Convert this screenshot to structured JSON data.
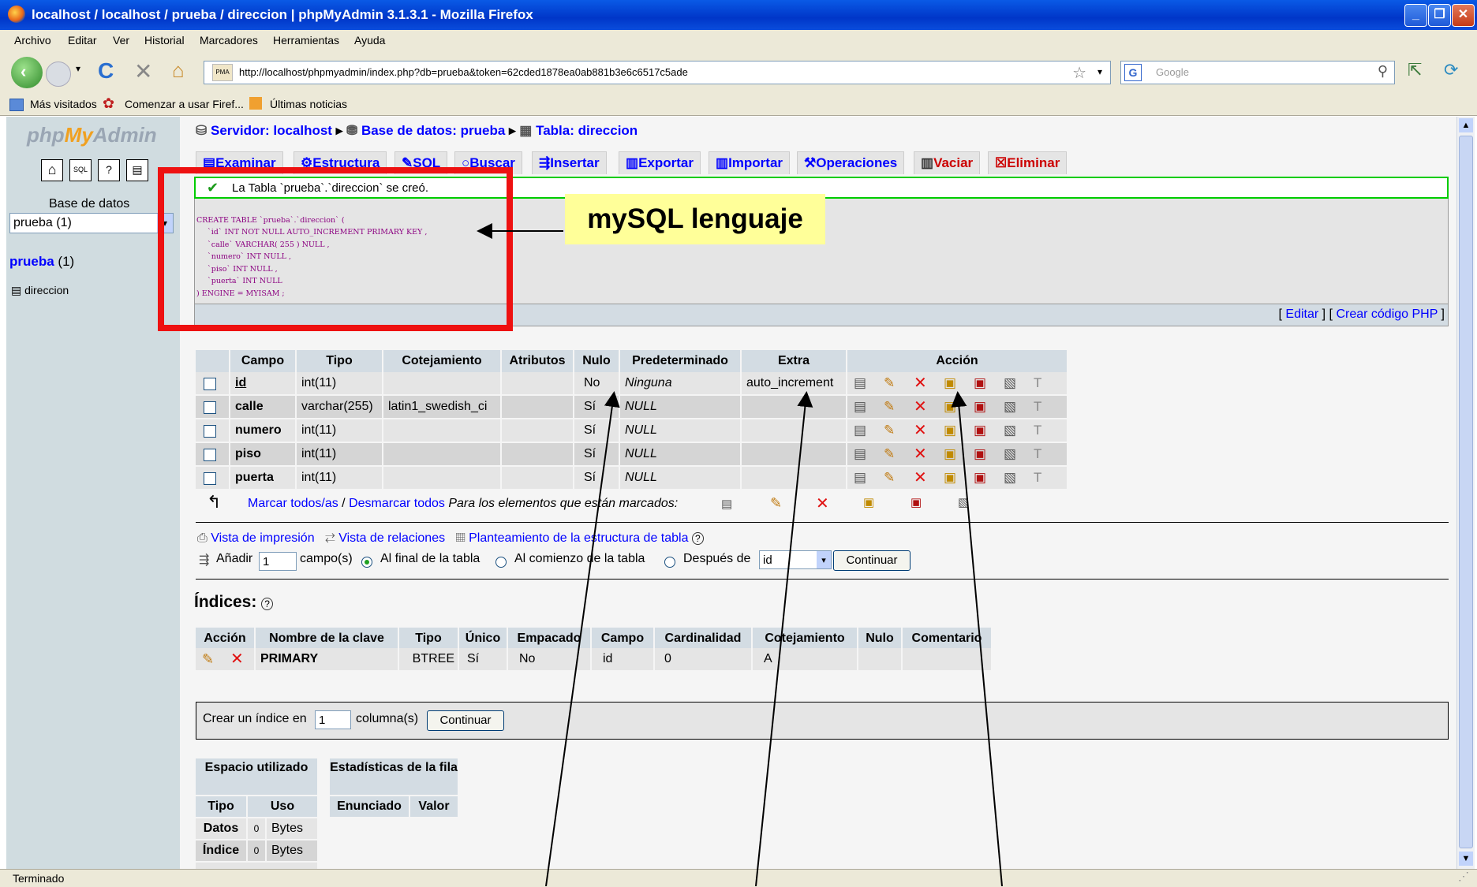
{
  "window": {
    "title": "localhost / localhost / prueba / direccion | phpMyAdmin 3.1.3.1 - Mozilla Firefox"
  },
  "menu": [
    "Archivo",
    "Editar",
    "Ver",
    "Historial",
    "Marcadores",
    "Herramientas",
    "Ayuda"
  ],
  "nav": {
    "url": "http://localhost/phpmyadmin/index.php?db=prueba&token=62cded1878ea0ab881b3e6c6517c5ade",
    "search_placeholder": "Google"
  },
  "bookmarks": [
    "Más visitados",
    "Comenzar a usar Firef...",
    "Últimas noticias"
  ],
  "left": {
    "logo": "phpMyAdmin",
    "db_label": "Base de datos",
    "db_select": "prueba (1)",
    "db_link": "prueba",
    "db_count": "(1)",
    "table": "direccion"
  },
  "breadcrumb": {
    "server": "Servidor: localhost",
    "database": "Base de datos: prueba",
    "table": "Tabla: direccion"
  },
  "tabs": [
    "Examinar",
    "Estructura",
    "SQL",
    "Buscar",
    "Insertar",
    "Exportar",
    "Importar",
    "Operaciones",
    "Vaciar",
    "Eliminar"
  ],
  "success": {
    "message": "La Tabla `prueba`.`direccion` se creó.",
    "sql_lines": [
      "CREATE TABLE `prueba`.`direccion` (",
      "`id` INT NOT NULL AUTO_INCREMENT PRIMARY KEY ,",
      "`calle` VARCHAR( 255 ) NULL ,",
      "`numero` INT NULL ,",
      "`piso` INT NULL ,",
      "`puerta` INT NULL",
      ") ENGINE = MYISAM ;"
    ],
    "edit_link": "Editar",
    "php_link": "Crear código PHP"
  },
  "annotation": {
    "label": "mySQL lenguaje"
  },
  "structure": {
    "headers": [
      "Campo",
      "Tipo",
      "Cotejamiento",
      "Atributos",
      "Nulo",
      "Predeterminado",
      "Extra",
      "Acción"
    ],
    "rows": [
      {
        "campo": "id",
        "tipo": "int(11)",
        "cotejamiento": "",
        "atributos": "",
        "nulo": "No",
        "predeterminado": "Ninguna",
        "extra": "auto_increment"
      },
      {
        "campo": "calle",
        "tipo": "varchar(255)",
        "cotejamiento": "latin1_swedish_ci",
        "atributos": "",
        "nulo": "Sí",
        "predeterminado": "NULL",
        "extra": ""
      },
      {
        "campo": "numero",
        "tipo": "int(11)",
        "cotejamiento": "",
        "atributos": "",
        "nulo": "Sí",
        "predeterminado": "NULL",
        "extra": ""
      },
      {
        "campo": "piso",
        "tipo": "int(11)",
        "cotejamiento": "",
        "atributos": "",
        "nulo": "Sí",
        "predeterminado": "NULL",
        "extra": ""
      },
      {
        "campo": "puerta",
        "tipo": "int(11)",
        "cotejamiento": "",
        "atributos": "",
        "nulo": "Sí",
        "predeterminado": "NULL",
        "extra": ""
      }
    ],
    "check_all": "Marcar todos/as",
    "sep": "/",
    "uncheck_all": "Desmarcar todos",
    "with_selected": "Para los elementos que están marcados:"
  },
  "links": {
    "print": "Vista de impresión",
    "relations": "Vista de relaciones",
    "structure_plan": "Planteamiento de la estructura de tabla"
  },
  "add_field": {
    "label": "Añadir",
    "count": "1",
    "fields_label": "campo(s)",
    "opt_end": "Al final de la tabla",
    "opt_start": "Al comienzo de la tabla",
    "opt_after": "Después de",
    "after_select": "id",
    "continue": "Continuar"
  },
  "indexes": {
    "title": "Índices:",
    "headers": [
      "Acción",
      "Nombre de la clave",
      "Tipo",
      "Único",
      "Empacado",
      "Campo",
      "Cardinalidad",
      "Cotejamiento",
      "Nulo",
      "Comentario"
    ],
    "row": {
      "nombre": "PRIMARY",
      "tipo": "BTREE",
      "unico": "Sí",
      "empacado": "No",
      "campo": "id",
      "cardinalidad": "0",
      "cotejamiento": "A",
      "nulo": "",
      "comentario": ""
    },
    "create_label": "Crear un índice en",
    "create_count": "1",
    "columns_label": "columna(s)",
    "continue": "Continuar"
  },
  "space": {
    "title": "Espacio utilizado",
    "headers": [
      "Tipo",
      "Uso"
    ],
    "rows": [
      {
        "tipo": "Datos",
        "valor": "0",
        "unidad": "Bytes"
      },
      {
        "tipo": "Índice",
        "valor": "0",
        "unidad": "Bytes"
      }
    ]
  },
  "row_stats": {
    "title": "Estadísticas de la fila",
    "headers": [
      "Enunciado",
      "Valor"
    ]
  },
  "status": "Terminado"
}
